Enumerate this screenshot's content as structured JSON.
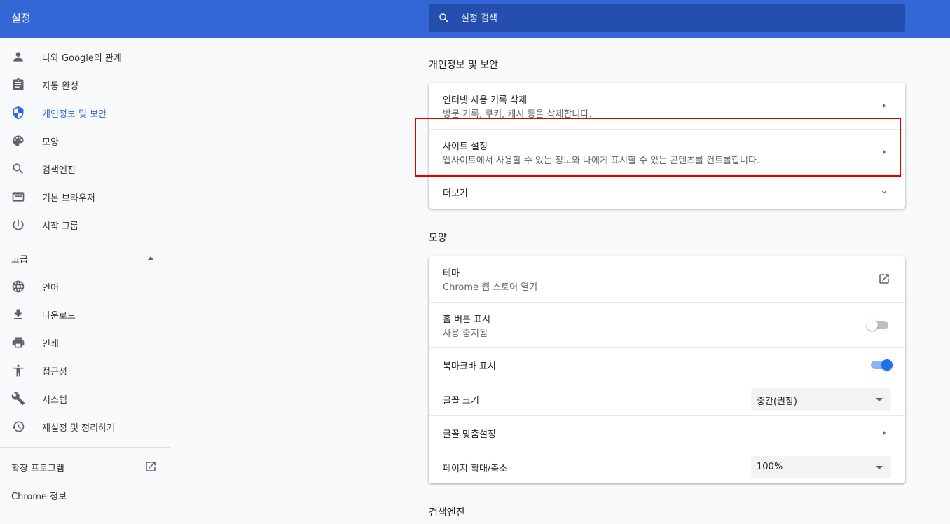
{
  "app": {
    "title": "설정"
  },
  "search": {
    "placeholder": "설정 검색"
  },
  "sidebar": {
    "items": [
      {
        "label": "나와 Google의 관계",
        "icon": "person-icon"
      },
      {
        "label": "자동 완성",
        "icon": "clipboard-icon"
      },
      {
        "label": "개인정보 및 보안",
        "icon": "shield-icon"
      },
      {
        "label": "모양",
        "icon": "palette-icon"
      },
      {
        "label": "검색엔진",
        "icon": "search-icon"
      },
      {
        "label": "기본 브라우저",
        "icon": "browser-window-icon"
      },
      {
        "label": "시작 그룹",
        "icon": "power-icon"
      }
    ],
    "advanced_label": "고급",
    "advanced_items": [
      {
        "label": "언어",
        "icon": "globe-icon"
      },
      {
        "label": "다운로드",
        "icon": "download-icon"
      },
      {
        "label": "인쇄",
        "icon": "printer-icon"
      },
      {
        "label": "접근성",
        "icon": "accessibility-icon"
      },
      {
        "label": "시스템",
        "icon": "wrench-icon"
      },
      {
        "label": "재설정 및 정리하기",
        "icon": "restore-icon"
      }
    ],
    "extensions_label": "확장 프로그램",
    "about_label": "Chrome 정보"
  },
  "privacy": {
    "title": "개인정보 및 보안",
    "clear": {
      "title": "인터넷 사용 기록 삭제",
      "sub": "방문 기록, 쿠키, 캐시 등을 삭제합니다."
    },
    "site": {
      "title": "사이트 설정",
      "sub": "웹사이트에서 사용할 수 있는 정보와 나에게 표시할 수 있는 콘텐츠를 컨트롤합니다."
    },
    "more": "더보기"
  },
  "appearance": {
    "title": "모양",
    "theme": {
      "title": "테마",
      "sub": "Chrome 웹 스토어 열기"
    },
    "home": {
      "title": "홈 버튼 표시",
      "sub": "사용 중지됨",
      "enabled": false
    },
    "bookmarks": {
      "title": "북마크바 표시",
      "enabled": true
    },
    "font_size": {
      "title": "글꼴 크기",
      "value": "중간(권장)"
    },
    "font_custom": {
      "title": "글꼴 맞춤설정"
    },
    "zoom": {
      "title": "페이지 확대/축소",
      "value": "100%"
    }
  },
  "search_engine": {
    "title": "검색엔진"
  },
  "colors": {
    "header": "#3367d6",
    "accent": "#1a73e8",
    "highlight": "#e00000"
  }
}
